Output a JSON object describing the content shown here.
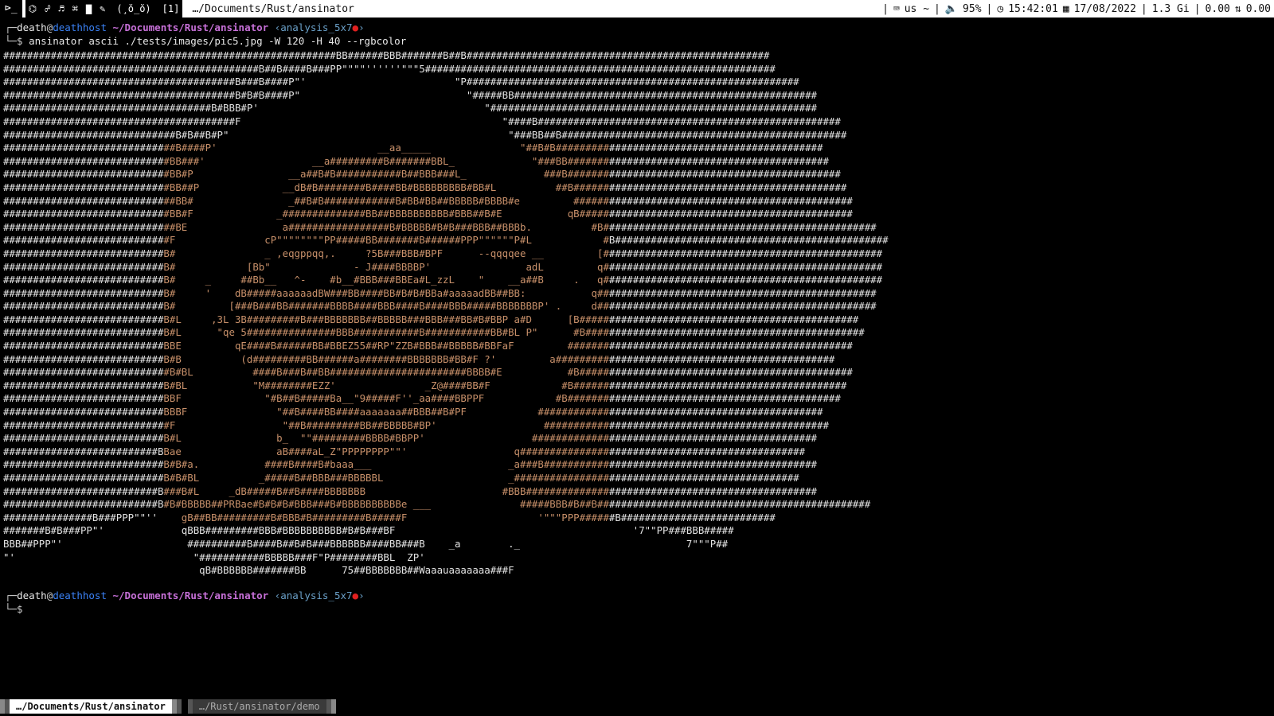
{
  "topbar": {
    "terminal_icon": "⊳_",
    "workspace_icons": [
      "⌬",
      "☍",
      "♬",
      "⌘",
      "▇",
      "✎"
    ],
    "face": "(¸ŏ_ŏ)",
    "workspace_index": "[1]",
    "window_title": "…/Documents/Rust/ansinator",
    "keyboard_layout": "us ~",
    "volume": "95%",
    "time": "15:42:01",
    "date": "17/08/2022",
    "memory": "1.3 Gi",
    "net_down": "0.00",
    "net_up": "0.00"
  },
  "prompt": {
    "user": "death",
    "host": "deathhost",
    "path": "~/Documents/Rust/ansinator",
    "branch": "‹analysis_5x7",
    "branch_end": "›",
    "command": "ansinator ascii ./tests/images/pic5.jpg -W 120 -H 40 --rgbcolor"
  },
  "ascii_lines": [
    "########################################################BB######BBB#######B##B###################################################",
    "###########################################B##B####B###PP\"\"\"\"''''''\"\"\"5###########################################################",
    "#######################################B###B####P\"'                         \"P########################################################",
    "#######################################B#B#B####P\"                            \"#####BB###################################################",
    "###################################B#BBB#P'                                      \"#######################################################",
    "#######################################F                                            \"####B###################################################",
    "#############################B#B##B#P\"                                               \"###BB##B################################################",
    "#############################B####P'                           __aa_____               \"##B#B#############################################",
    "############################BB###'                  __a#########B#######BBL_             \"###BB############################################",
    "############################BB#P                __a##B#B###########B##BBB###L_             ###B##############################################",
    "############################BB##P              __dB#B########B####BB#BBBBBBBBB#BB#L          ##B##############################################",
    "#############################BB#                _##B#B############B#BB#BB##BBBBB#BBBB#e         ###############################################",
    "############################BB#F              _##############BB##BBBBBBBBBB#BBB##B#E           qB##############################################",
    "#############################BE                a#################B#BBBBB#B#B###BBB##BBBb.          #B##############################################",
    "############################F               cP\"\"\"\"\"\"\"\"PP#####BB#######B######PPP\"\"\"\"\"\"P#L            #B##############################################",
    "###########################B#               _ ,eqgppqq,.     ?5B###BBB#BPF      --qqqqee __         [###############################################",
    "###########################B#            [Bb\"              - J####BBBBP'                adL         q###############################################",
    "###########################B#     _     ##Bb__   ^-    #b__#BBB###BBEa#L_zzL    \"    __a##B     .   q###############################################",
    "###########################B#     '    dB#####aaaaaadBW###BB####BB#B#B#BBa#aaaaadBB##BB:           q###############################################",
    "###########################B#         [###B###BB#######BBBB####BBB####B####BBB#####BBBBBBBP' .     d###############################################",
    "###########################B#L     ,3L 3B#########B###BBBBBBB##BBBBB###BBB###BB#B#BBP a#D      [B###############################################",
    "###########################B#L      \"qe 5###############BBB###########B###########BB#BL P\"      #B###############################################",
    "###########################BBE         qE####B######BB#BBEZ55##RP\"ZZB#BBB##BBBBB#BBFaF         ################################################",
    "###########################B#B          (d#########BB######a########BBBBBBB#BB#F ?'         a###############################################",
    "############################B#BL          ####B###B##BB#######################BBBB#E           #B##############################################",
    "###########################B#BL           \"M########EZZ'               _Z@####BB#F            #B##############################################",
    "###########################BBF              \"#B##B#####Ba__\"9#####F''_aa####BBPPF            #B##############################################",
    "###########################BBBF               \"##B####BB####aaaaaaa##BBB##B#PF            ################################################",
    "############################F                  \"##B#########BB##BBBBB#BP'                  ################################################",
    "###########################B#L                b_  \"\"#########BBBB#BBPP'                  ################################################",
    "##########################BBae                aB####aL_Z\"PPPPPPPP\"\"'                  q################################################",
    "###########################B#B#a.           ####B####B#baaa___                       _a###B##############################################",
    "###########################B#B#BL          _#####B##BBB###BBBBBL                     _################################################",
    "##########################B###B#L     _dB#####B##B####BBBBBBB                       #BBB#################################################",
    "##########################B#B#BBBBB##PRBae#B#B#B#BBB###B#BBBBBBBBBBe ___               #####BBB#B##B##############################################",
    "###############B###PPP\"\"''    gB##BB#########B#BBB#B#########B#####F                      '\"\"\"PPP######B##########################",
    "#######B#B###PP\"'             qBBB#########BBB#BBBBBBBBBB#B#B###BF                                        '7\"\"PP###BBB#####",
    "BBB##PPP\"'                     ##########B####B##B#B###BBBBBB####BB###B    _a        ._                            7\"\"\"P##",
    "\"'                              \"###########BBBBB###F\"P########BBL  ZP'",
    "                                 qB#BBBBBB#######BB      75##BBBBBBB##Waaauaaaaaaa###F"
  ],
  "tabs": {
    "active": "…/Documents/Rust/ansinator",
    "inactive": "…/Rust/ansinator/demo"
  }
}
